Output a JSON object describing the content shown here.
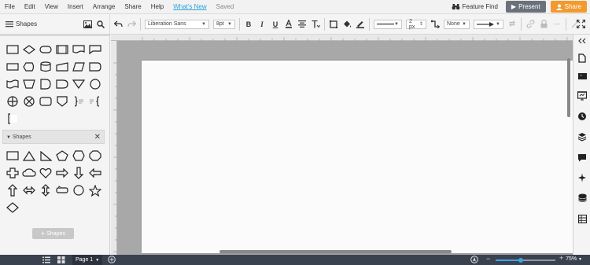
{
  "menubar": {
    "items": [
      "File",
      "Edit",
      "View",
      "Insert",
      "Arrange",
      "Share",
      "Help",
      "What's New",
      "Saved"
    ],
    "feature_find": "Feature Find",
    "present": "Present",
    "share": "Share",
    "colors": {
      "present_bg": "#6b717b",
      "share_bg": "#f29a2e",
      "whats_new": "#2aa0e0"
    }
  },
  "toolbar": {
    "font_family": "Liberation Sans",
    "font_size": "8pt",
    "line_width": "2 px",
    "line_end_start": "None"
  },
  "sidebar": {
    "title": "Shapes",
    "section_title": "Shapes",
    "add_shapes_label": "Shapes",
    "flowchart_icons": [
      "rectangle",
      "diamond",
      "terminator",
      "process",
      "document",
      "note",
      "data",
      "display",
      "drum",
      "manual-input",
      "parallelogram",
      "delay",
      "tape",
      "trapezoid",
      "delay-rounded",
      "delay-wide",
      "merge",
      "connector",
      "or",
      "summing",
      "off-page",
      "shield",
      "bracket-note",
      "brace-note",
      "bracket"
    ],
    "basic_icons": [
      "rectangle",
      "triangle",
      "right-triangle",
      "pentagon",
      "hexagon",
      "octagon",
      "cross",
      "cloud",
      "heart",
      "arrow-right",
      "arrow-down",
      "arrow-left",
      "arrow-up",
      "double-arrow",
      "vertical-double-arrow",
      "callout",
      "circle",
      "star",
      "diamond"
    ]
  },
  "bottombar": {
    "page_label": "Page 1",
    "zoom_label": "75%",
    "zoom_level_percent": 42
  }
}
